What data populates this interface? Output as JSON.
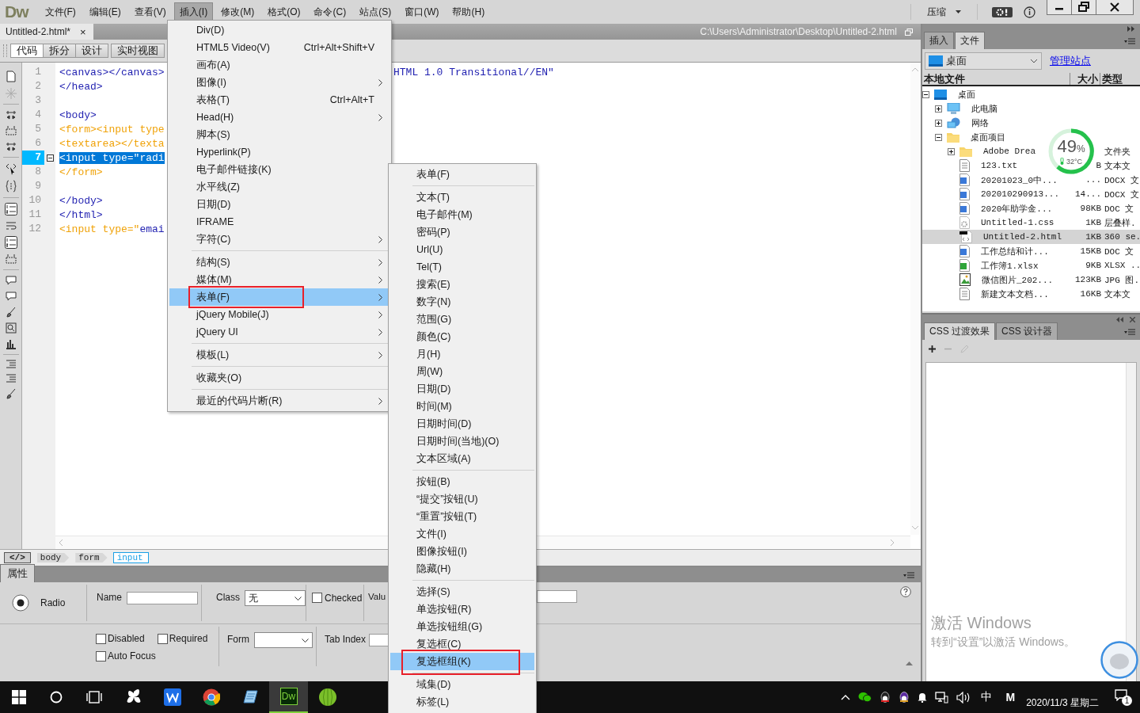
{
  "menubar": {
    "logo": "Dw",
    "menus": [
      {
        "label": "文件(F)",
        "selected": false
      },
      {
        "label": "编辑(E)",
        "selected": false
      },
      {
        "label": "查看(V)",
        "selected": false
      },
      {
        "label": "插入(I)",
        "selected": true
      },
      {
        "label": "修改(M)",
        "selected": false
      },
      {
        "label": "格式(O)",
        "selected": false
      },
      {
        "label": "命令(C)",
        "selected": false
      },
      {
        "label": "站点(S)",
        "selected": false
      },
      {
        "label": "窗口(W)",
        "selected": false
      },
      {
        "label": "帮助(H)",
        "selected": false
      }
    ],
    "compress": "压缩"
  },
  "document": {
    "tab": "Untitled-2.html*",
    "close": "×",
    "path": "C:\\Users\\Administrator\\Desktop\\Untitled-2.html"
  },
  "view_buttons": [
    {
      "label": "代码",
      "selected": true
    },
    {
      "label": "拆分",
      "selected": false
    },
    {
      "label": "设计",
      "selected": false
    },
    {
      "label": "实时视图",
      "selected": false
    }
  ],
  "code_lines": [
    {
      "number": "1",
      "selected": false,
      "segments": [
        {
          "text": "<canvas></canvas>",
          "color": "#1f1fb0"
        }
      ],
      "tail": "HTML 1.0 Transitional//EN\""
    },
    {
      "number": "2",
      "selected": false,
      "segments": [
        {
          "text": "</head>",
          "color": "#1f1fb0"
        }
      ]
    },
    {
      "number": "3",
      "selected": false
    },
    {
      "number": "4",
      "selected": false,
      "segments": [
        {
          "text": "<body>",
          "color": "#1f1fb0"
        }
      ]
    },
    {
      "number": "5",
      "selected": false,
      "segments": [
        {
          "text": "<form><input type",
          "color": "#f0a30a"
        }
      ]
    },
    {
      "number": "6",
      "selected": false,
      "segments": [
        {
          "text": "<textarea></texta",
          "color": "#f0a30a"
        }
      ]
    },
    {
      "number": "7",
      "selected": true,
      "segments": [
        {
          "text": "<input type=\"radi"
        }
      ]
    },
    {
      "number": "8",
      "selected": false,
      "segments": [
        {
          "text": "</form>",
          "color": "#f0a30a"
        }
      ]
    },
    {
      "number": "9",
      "selected": false
    },
    {
      "number": "10",
      "selected": false,
      "segments": [
        {
          "text": "</body>",
          "color": "#1f1fb0"
        }
      ]
    },
    {
      "number": "11",
      "selected": false,
      "segments": [
        {
          "text": "</html>",
          "color": "#1f1fb0"
        }
      ]
    },
    {
      "number": "12",
      "selected": false,
      "segments": [
        {
          "text": "<input type=\"",
          "color": "#f0a30a"
        },
        {
          "text": "emai",
          "color": "#1f1fb0"
        }
      ]
    }
  ],
  "tag_selector": {
    "code_button": "</>",
    "tags": [
      {
        "label": "body",
        "selected": false
      },
      {
        "label": "form",
        "selected": false
      },
      {
        "label": "input",
        "selected": true
      }
    ]
  },
  "properties": {
    "title": "属性",
    "element": "Radio",
    "name_label": "Name",
    "class_label": "Class",
    "class_value": "无",
    "checked_label": "Checked",
    "checked": false,
    "value_label": "Valu",
    "disabled_label": "Disabled",
    "disabled": false,
    "required_label": "Required",
    "required": false,
    "form_label": "Form",
    "tab_index_label": "Tab Index",
    "auto_focus_label": "Auto Focus",
    "auto_focus": false
  },
  "insert_menu": {
    "items": [
      {
        "kind": "item",
        "label": "Div(D)",
        "selected": false,
        "annotated": false,
        "submenu": false
      },
      {
        "kind": "item",
        "label": "HTML5 Video(V)",
        "shortcut": "Ctrl+Alt+Shift+V",
        "selected": false,
        "annotated": false,
        "submenu": false
      },
      {
        "kind": "item",
        "label": "画布(A)",
        "selected": false,
        "annotated": false,
        "submenu": false
      },
      {
        "kind": "item",
        "label": "图像(I)",
        "selected": false,
        "annotated": false,
        "submenu": true
      },
      {
        "kind": "item",
        "label": "表格(T)",
        "shortcut": "Ctrl+Alt+T",
        "selected": false,
        "annotated": false,
        "submenu": false
      },
      {
        "kind": "item",
        "label": "Head(H)",
        "selected": false,
        "annotated": false,
        "submenu": true
      },
      {
        "kind": "item",
        "label": "脚本(S)",
        "selected": false,
        "annotated": false,
        "submenu": false
      },
      {
        "kind": "item",
        "label": "Hyperlink(P)",
        "selected": false,
        "annotated": false,
        "submenu": false
      },
      {
        "kind": "item",
        "label": "电子邮件链接(K)",
        "selected": false,
        "annotated": false,
        "submenu": false
      },
      {
        "kind": "item",
        "label": "水平线(Z)",
        "selected": false,
        "annotated": false,
        "submenu": false
      },
      {
        "kind": "item",
        "label": "日期(D)",
        "selected": false,
        "annotated": false,
        "submenu": false
      },
      {
        "kind": "item",
        "label": "IFRAME",
        "selected": false,
        "annotated": false,
        "submenu": false
      },
      {
        "kind": "item",
        "label": "字符(C)",
        "selected": false,
        "annotated": false,
        "submenu": true
      },
      {
        "kind": "separator"
      },
      {
        "kind": "item",
        "label": "结构(S)",
        "selected": false,
        "annotated": false,
        "submenu": true
      },
      {
        "kind": "item",
        "label": "媒体(M)",
        "selected": false,
        "annotated": false,
        "submenu": true
      },
      {
        "kind": "item",
        "label": "表单(F)",
        "selected": true,
        "annotated": true,
        "submenu": true
      },
      {
        "kind": "item",
        "label": "jQuery Mobile(J)",
        "selected": false,
        "annotated": false,
        "submenu": true
      },
      {
        "kind": "item",
        "label": "jQuery UI",
        "selected": false,
        "annotated": false,
        "submenu": true
      },
      {
        "kind": "separator"
      },
      {
        "kind": "item",
        "label": "模板(L)",
        "selected": false,
        "annotated": false,
        "submenu": true
      },
      {
        "kind": "separator"
      },
      {
        "kind": "item",
        "label": "收藏夹(O)",
        "selected": false,
        "annotated": false,
        "submenu": false
      },
      {
        "kind": "separator"
      },
      {
        "kind": "item",
        "label": "最近的代码片断(R)",
        "selected": false,
        "annotated": false,
        "submenu": true
      }
    ]
  },
  "form_submenu": {
    "items": [
      {
        "kind": "item",
        "label": "表单(F)",
        "selected": false,
        "annotated": false
      },
      {
        "kind": "separator"
      },
      {
        "kind": "item",
        "label": "文本(T)",
        "selected": false,
        "annotated": false
      },
      {
        "kind": "item",
        "label": "电子邮件(M)",
        "selected": false,
        "annotated": false
      },
      {
        "kind": "item",
        "label": "密码(P)",
        "selected": false,
        "annotated": false
      },
      {
        "kind": "item",
        "label": "Url(U)",
        "selected": false,
        "annotated": false
      },
      {
        "kind": "item",
        "label": "Tel(T)",
        "selected": false,
        "annotated": false
      },
      {
        "kind": "item",
        "label": "搜索(E)",
        "selected": false,
        "annotated": false
      },
      {
        "kind": "item",
        "label": "数字(N)",
        "selected": false,
        "annotated": false
      },
      {
        "kind": "item",
        "label": "范围(G)",
        "selected": false,
        "annotated": false
      },
      {
        "kind": "item",
        "label": "颜色(C)",
        "selected": false,
        "annotated": false
      },
      {
        "kind": "item",
        "label": "月(H)",
        "selected": false,
        "annotated": false
      },
      {
        "kind": "item",
        "label": "周(W)",
        "selected": false,
        "annotated": false
      },
      {
        "kind": "item",
        "label": "日期(D)",
        "selected": false,
        "annotated": false
      },
      {
        "kind": "item",
        "label": "时间(M)",
        "selected": false,
        "annotated": false
      },
      {
        "kind": "item",
        "label": "日期时间(D)",
        "selected": false,
        "annotated": false
      },
      {
        "kind": "item",
        "label": "日期时间(当地)(O)",
        "selected": false,
        "annotated": false
      },
      {
        "kind": "item",
        "label": "文本区域(A)",
        "selected": false,
        "annotated": false
      },
      {
        "kind": "separator"
      },
      {
        "kind": "item",
        "label": "按钮(B)",
        "selected": false,
        "annotated": false
      },
      {
        "kind": "item",
        "label": "“提交”按钮(U)",
        "selected": false,
        "annotated": false
      },
      {
        "kind": "item",
        "label": "“重置”按钮(T)",
        "selected": false,
        "annotated": false
      },
      {
        "kind": "item",
        "label": "文件(I)",
        "selected": false,
        "annotated": false
      },
      {
        "kind": "item",
        "label": "图像按钮(I)",
        "selected": false,
        "annotated": false
      },
      {
        "kind": "item",
        "label": "隐藏(H)",
        "selected": false,
        "annotated": false
      },
      {
        "kind": "separator"
      },
      {
        "kind": "item",
        "label": "选择(S)",
        "selected": false,
        "annotated": false
      },
      {
        "kind": "item",
        "label": "单选按钮(R)",
        "selected": false,
        "annotated": false
      },
      {
        "kind": "item",
        "label": "单选按钮组(G)",
        "selected": false,
        "annotated": false
      },
      {
        "kind": "item",
        "label": "复选框(C)",
        "selected": false,
        "annotated": false
      },
      {
        "kind": "item",
        "label": "复选框组(K)",
        "selected": true,
        "annotated": true
      },
      {
        "kind": "separator"
      },
      {
        "kind": "item",
        "label": "域集(D)",
        "selected": false,
        "annotated": false
      },
      {
        "kind": "item",
        "label": "标签(L)",
        "selected": false,
        "annotated": false
      }
    ]
  },
  "files_panel": {
    "tabs": [
      {
        "label": "插入",
        "selected": false
      },
      {
        "label": "文件",
        "selected": true
      }
    ],
    "site": "桌面",
    "manage_link": "管理站点",
    "columns": [
      "本地文件",
      "大小",
      "类型"
    ],
    "tree": [
      {
        "name": "桌面",
        "kind": "desktop",
        "selected": false,
        "expanded": true,
        "children": [
          {
            "name": "此电脑",
            "kind": "computer",
            "selected": false,
            "expanded": false
          },
          {
            "name": "网络",
            "kind": "network",
            "selected": false,
            "expanded": false
          },
          {
            "name": "桌面项目",
            "kind": "folder",
            "selected": false,
            "expanded": true,
            "children": [
              {
                "name": "Adobe Drea",
                "kind": "folder",
                "type": "文件夹",
                "selected": false,
                "expanded": false
              },
              {
                "name": "123.txt",
                "kind": "text",
                "size": "B",
                "type": "文本文",
                "selected": false
              },
              {
                "name": "20201023_0中...",
                "kind": "word",
                "size": "...",
                "type": "DOCX 文",
                "selected": false
              },
              {
                "name": "202010290913...",
                "kind": "word",
                "size": "14...",
                "type": "DOCX 文",
                "selected": false
              },
              {
                "name": "2020年助学金...",
                "kind": "word",
                "size": "98KB",
                "type": "DOC 文",
                "selected": false
              },
              {
                "name": "Untitled-1.css",
                "kind": "css",
                "size": "1KB",
                "type": "层叠样.",
                "selected": false
              },
              {
                "name": "Untitled-2.html",
                "kind": "html",
                "size": "1KB",
                "type": "360 se.",
                "selected": true
              },
              {
                "name": "工作总结和计...",
                "kind": "word",
                "size": "15KB",
                "type": "DOC 文",
                "selected": false
              },
              {
                "name": "工作簿1.xlsx",
                "kind": "sheet",
                "size": "9KB",
                "type": "XLSX ..",
                "selected": false
              },
              {
                "name": "微信图片_202...",
                "kind": "image",
                "size": "123KB",
                "type": "JPG 图.",
                "selected": false
              },
              {
                "name": "新建文本文档...",
                "kind": "text",
                "size": "16KB",
                "type": "文本文",
                "selected": false
              }
            ]
          }
        ]
      }
    ]
  },
  "monitor_widget": {
    "percent": "49",
    "unit": "%",
    "temperature": "32°C"
  },
  "css_panel": {
    "tabs": [
      {
        "label": "CSS 过渡效果",
        "selected": true
      },
      {
        "label": "CSS 设计器",
        "selected": false
      }
    ]
  },
  "activation": {
    "title": "激活 Windows",
    "subtitle": "转到“设置”以激活 Windows。"
  },
  "taskbar": {
    "apps": [
      {
        "kind": "pinwheel",
        "selected": false
      },
      {
        "kind": "wps",
        "selected": false
      },
      {
        "kind": "chrome",
        "selected": false
      },
      {
        "kind": "notepad",
        "selected": false
      },
      {
        "kind": "dw",
        "label": "Dw",
        "selected": true
      },
      {
        "kind": "ball",
        "selected": false
      }
    ],
    "ime": "中",
    "ime_mode": "M",
    "date": "2020/11/3 星期二",
    "notifications": "1"
  }
}
